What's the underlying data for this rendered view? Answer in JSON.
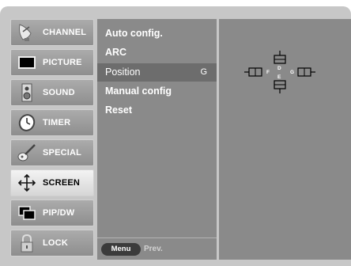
{
  "sidebar": {
    "items": [
      {
        "label": "CHANNEL",
        "icon": "satellite-dish-icon",
        "active": false
      },
      {
        "label": "PICTURE",
        "icon": "monitor-icon",
        "active": false
      },
      {
        "label": "SOUND",
        "icon": "speaker-icon",
        "active": false
      },
      {
        "label": "TIMER",
        "icon": "clock-icon",
        "active": false
      },
      {
        "label": "SPECIAL",
        "icon": "guitar-icon",
        "active": false
      },
      {
        "label": "SCREEN",
        "icon": "move-arrows-icon",
        "active": true
      },
      {
        "label": "PIP/DW",
        "icon": "pip-windows-icon",
        "active": false
      },
      {
        "label": "LOCK",
        "icon": "padlock-icon",
        "active": false
      }
    ]
  },
  "menu": {
    "items": [
      {
        "label": "Auto config.",
        "selected": false
      },
      {
        "label": "ARC",
        "selected": false
      },
      {
        "label": "Position",
        "selected": true,
        "key": "G"
      },
      {
        "label": "Manual config",
        "selected": false
      },
      {
        "label": "Reset",
        "selected": false
      }
    ],
    "footer": {
      "button_label": "Menu",
      "action_label": "Prev."
    }
  },
  "position_panel": {
    "labels": {
      "up": "D",
      "down": "E",
      "left": "F",
      "right": "G"
    }
  },
  "colors": {
    "frame": "#c7c7c7",
    "panel": "#8a8a8a",
    "selected_row": "#6d6d6d",
    "active_tab": "#e6e6e6"
  }
}
